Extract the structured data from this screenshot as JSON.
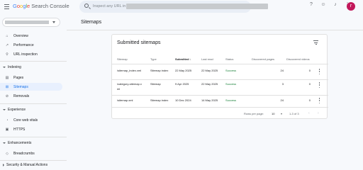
{
  "header": {
    "logo_google": "Google",
    "logo_product": "Search Console",
    "search_placeholder": "Inspect any URL in",
    "help_icon": "help-icon",
    "people_icon": "people-icon",
    "bell_icon": "bell-icon",
    "apps_icon": "apps-grid-icon",
    "avatar_initial": "r",
    "avatar_color": "#c2185b"
  },
  "sidebar": {
    "items_top": [
      {
        "label": "Overview",
        "icon": "home-icon"
      },
      {
        "label": "Performance",
        "icon": "trend-icon"
      },
      {
        "label": "URL inspection",
        "icon": "search-icon"
      }
    ],
    "sections": [
      {
        "label": "Indexing",
        "items": [
          {
            "label": "Pages",
            "icon": "pages-icon"
          },
          {
            "label": "Sitemaps",
            "icon": "sitemap-icon",
            "active": true
          },
          {
            "label": "Removals",
            "icon": "removals-icon"
          }
        ]
      },
      {
        "label": "Experience",
        "items": [
          {
            "label": "Core web vitals",
            "icon": "speedometer-icon"
          },
          {
            "label": "HTTPS",
            "icon": "lock-icon"
          }
        ]
      },
      {
        "label": "Enhancements",
        "items": [
          {
            "label": "Breadcrumbs",
            "icon": "breadcrumbs-icon"
          }
        ]
      },
      {
        "label": "Security & Manual Actions",
        "items": []
      }
    ]
  },
  "main": {
    "page_title": "Sitemaps",
    "card_title": "Submitted sitemaps",
    "columns": [
      "Sitemap",
      "Type",
      "Submitted",
      "Last read",
      "Status",
      "Discovered pages",
      "Discovered videos"
    ],
    "rows": [
      {
        "sitemap": "/sitemap_index.xml",
        "sitemap2": "",
        "type": "Sitemap index",
        "submitted": "22 May 2025",
        "last_read": "22 May 2025",
        "status": "Success",
        "pages": "24",
        "videos": "0"
      },
      {
        "sitemap": "/category-sitemap.x",
        "sitemap2": "ml",
        "type": "Sitemap",
        "submitted": "9 Apr 2025",
        "last_read": "22 May 2025",
        "status": "Success",
        "pages": "3",
        "videos": "0"
      },
      {
        "sitemap": "/sitemap.xml",
        "sitemap2": "",
        "type": "Sitemap index",
        "submitted": "10 Dec 2024",
        "last_read": "14 May 2025",
        "status": "Success",
        "pages": "24",
        "videos": "0"
      }
    ],
    "rows_per_page_label": "Rows per page:",
    "rows_per_page_value": "10",
    "range": "1-3 of 3"
  },
  "colors": {
    "accent": "#1a73e8",
    "active_bg": "#e8f0fe",
    "success": "#188038",
    "background": "#f7f9fc"
  }
}
